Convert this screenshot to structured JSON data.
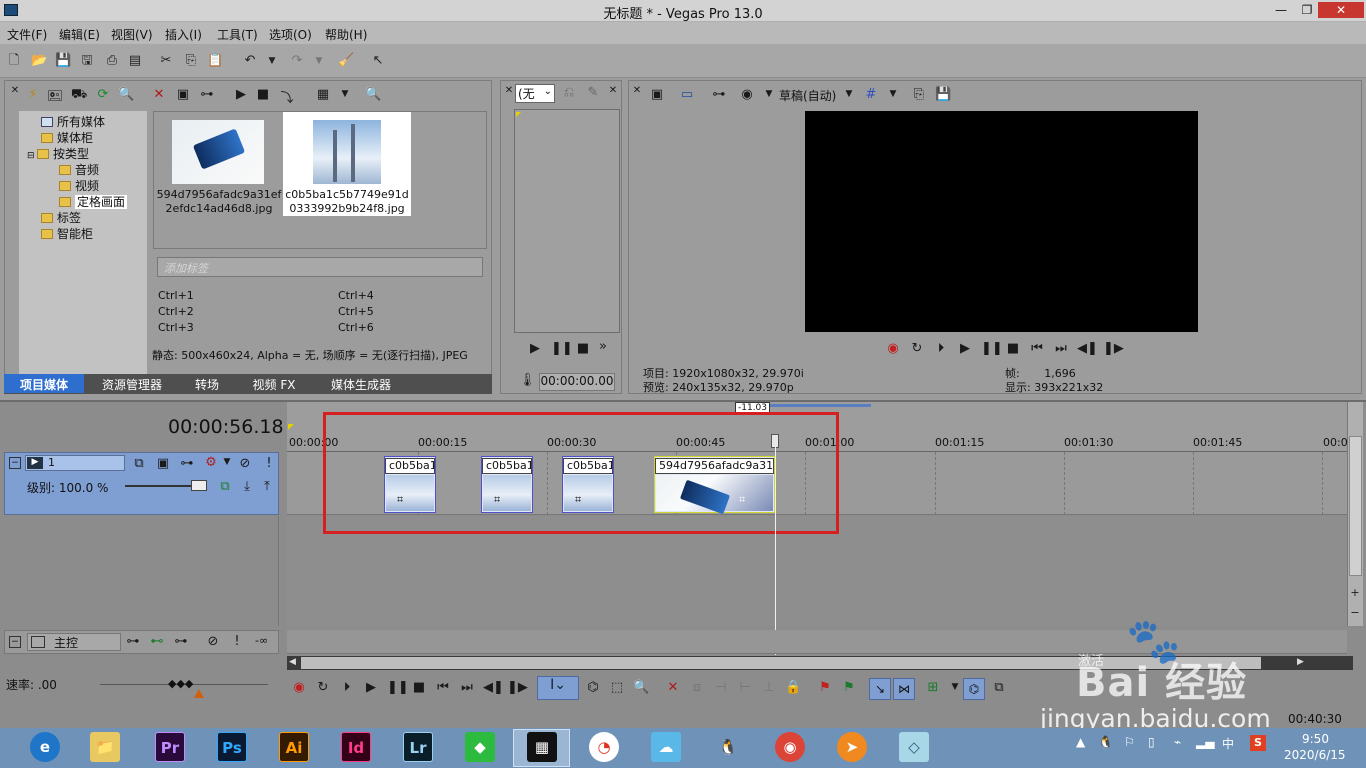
{
  "window": {
    "title": "无标题 * - Vegas Pro 13.0",
    "minimize": "—",
    "restore": "❐",
    "close": "✕"
  },
  "menu": [
    "文件(F)",
    "编辑(E)",
    "视图(V)",
    "插入(I)",
    "工具(T)",
    "选项(O)",
    "帮助(H)"
  ],
  "media_tree": [
    "所有媒体",
    "媒体柜",
    "按类型",
    "音频",
    "视频",
    "定格画面",
    "标签",
    "智能柜"
  ],
  "media_files": [
    {
      "name_line1": "594d7956afadc9a31ef",
      "name_line2": "2efdc14ad46d8.jpg"
    },
    {
      "name_line1": "c0b5ba1c5b7749e91d",
      "name_line2": "0333992b9b24f8.jpg"
    }
  ],
  "tag_placeholder": "添加标签",
  "shortcuts": [
    "Ctrl+1",
    "Ctrl+4",
    "Ctrl+2",
    "Ctrl+5",
    "Ctrl+3",
    "Ctrl+6"
  ],
  "media_info": "静态: 500x460x24, Alpha = 无, 场顺序 = 无(逐行扫描), JPEG",
  "tabs": [
    "项目媒体",
    "资源管理器",
    "转场",
    "视频 FX",
    "媒体生成器"
  ],
  "trimmer": {
    "dropdown": "(无",
    "time": "00:00:00.00"
  },
  "preview": {
    "quality": "草稿(自动)",
    "project_label": "项目:",
    "project_value": "1920x1080x32, 29.970i",
    "preview_label": "预览:",
    "preview_value": "240x135x32, 29.970p",
    "frame_label": "帧:",
    "frame_value": "1,696",
    "display_label": "显示:",
    "display_value": "393x221x32"
  },
  "timeline": {
    "current_time": "00:00:56.18",
    "marker": "-11.03",
    "ticks": [
      "00:00:00",
      "00:00:15",
      "00:00:30",
      "00:00:45",
      "00:01:00",
      "00:01:15",
      "00:01:30",
      "00:01:45",
      "00:0"
    ],
    "track_number": "1",
    "level": "级别: 100.0 %",
    "clips": [
      "c0b5ba1",
      "c0b5ba1",
      "c0b5ba1",
      "594d7956afadc9a31e"
    ],
    "master": "主控",
    "rate": "速率: .00",
    "master_inf": "-∞"
  },
  "watermark": {
    "brand": "Bai 经验",
    "url": "jingyan.baidu.com",
    "extra": "激活"
  },
  "taskbar": {
    "apps": [
      "e",
      "📁",
      "Pr",
      "Ps",
      "Ai",
      "Id",
      "Lr",
      "◆",
      "▦",
      "◔",
      "☁",
      "🐧",
      "◉",
      "➤",
      "◇"
    ],
    "time": "9:50",
    "date": "2020/6/15",
    "ime": "中",
    "status_time": "00:40:30"
  },
  "colors": {
    "accent": "#2e6ecf",
    "selection_box": "#d42020",
    "track_header": "#7f9fd2",
    "video_bg": "#000000"
  }
}
